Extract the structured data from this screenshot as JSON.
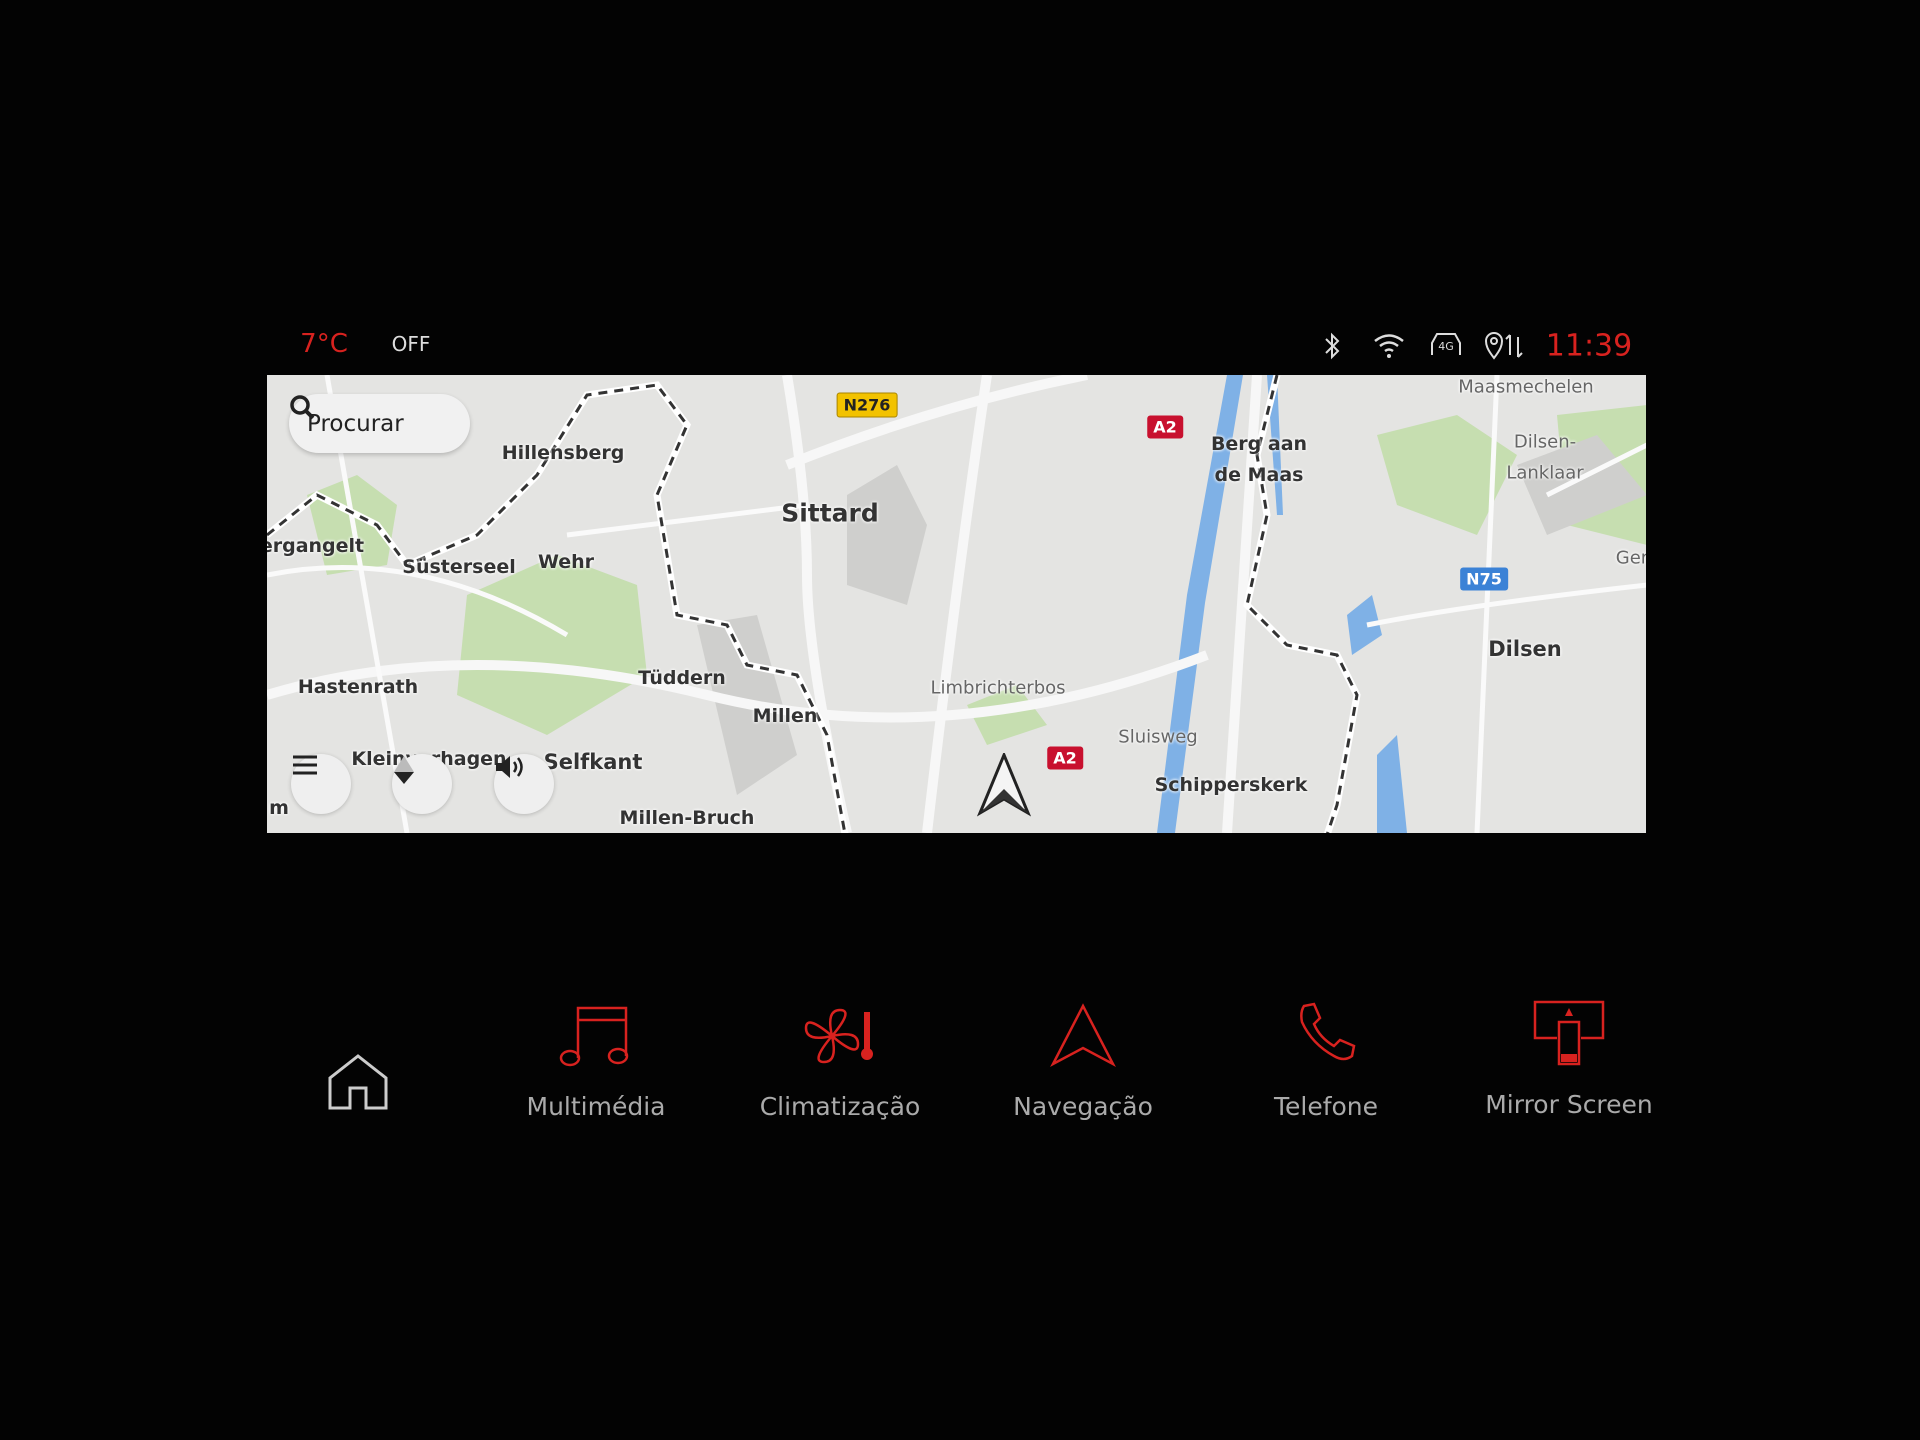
{
  "status_bar": {
    "temperature": "7°C",
    "climate_state": "OFF",
    "time": "11:39",
    "icons": [
      "bluetooth-icon",
      "wifi-icon",
      "4g-connected-car-icon",
      "location-sync-icon"
    ]
  },
  "map": {
    "search_label": "Procurar",
    "places": [
      "Hillensberg",
      "Sittard",
      "ergangelt",
      "Süsterseel",
      "Wehr",
      "Hastenrath",
      "Tüddern",
      "Millen",
      "Kleinv..rhagen",
      "Selfkant",
      "Millen-Bruch",
      "Limbrichterbos",
      "Sluisweg",
      "Schipperskerk",
      "Berg aan",
      "de Maas",
      "Maasmechelen",
      "Dilsen-",
      "Lanklaar",
      "Dilsen",
      "Ger",
      "m"
    ],
    "road_shields": {
      "n276": "N276",
      "a2_top": "A2",
      "a2_bottom": "A2",
      "n75": "N75"
    },
    "controls": [
      "menu-icon",
      "compass-icon",
      "volume-icon"
    ],
    "colors": {
      "land": "#e4e4e2",
      "water": "#7fb1e6",
      "park": "#c6deb0",
      "motorway_shield": "#c8102e",
      "national_shield": "#f2c200",
      "n_blue_shield": "#3b82d6"
    }
  },
  "dock": {
    "home": "home-icon",
    "items": [
      {
        "label": "Multimédia",
        "icon": "music-note-icon"
      },
      {
        "label": "Climatização",
        "icon": "fan-thermometer-icon"
      },
      {
        "label": "Navegação",
        "icon": "navigation-arrow-icon"
      },
      {
        "label": "Telefone",
        "icon": "phone-icon"
      },
      {
        "label": "Mirror Screen",
        "icon": "mirror-screen-icon"
      }
    ],
    "accent": "#d8221f"
  }
}
